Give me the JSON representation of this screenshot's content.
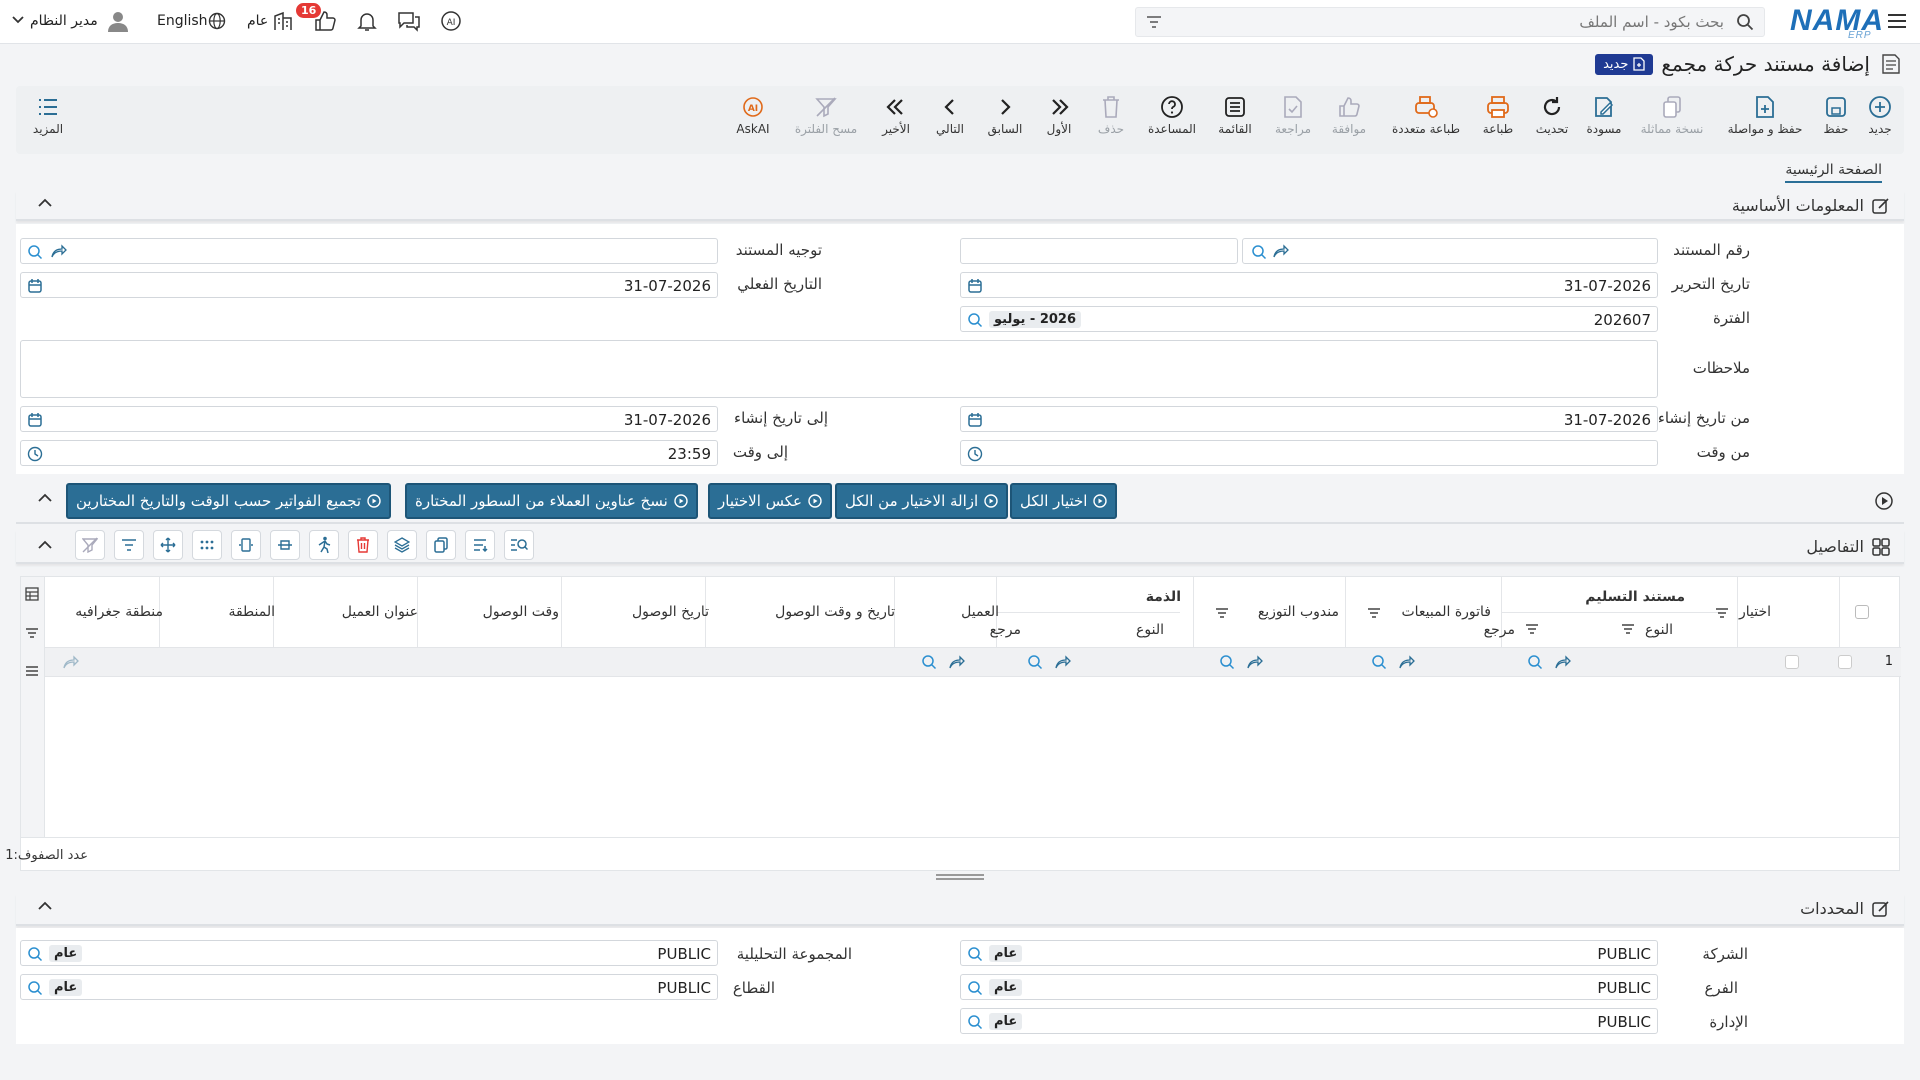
{
  "topbar": {
    "search_placeholder": "بحث بكود - اسم الملف",
    "logo": "NAMA",
    "logo_sub": "ERP",
    "user": "مدير النظام",
    "language": "English",
    "public_label": "عام",
    "notif_count": "16"
  },
  "page": {
    "title": "إضافة مستند حركة مجمع",
    "badge": "جديد"
  },
  "toolbar": {
    "new": "جديد",
    "save": "حفظ",
    "save_continue": "حفظ و مواصلة",
    "duplicate": "نسخة مماثلة",
    "draft": "مسودة",
    "refresh": "تحديث",
    "print": "طباعة",
    "multi_print": "طباعة متعددة",
    "approve": "موافقة",
    "review": "مراجعة",
    "list": "القائمة",
    "help": "المساعدة",
    "delete": "حذف",
    "first": "الأول",
    "previous": "السابق",
    "next": "التالي",
    "last": "الأخير",
    "clear_filter": "مسح الفلترة",
    "askai": "AskAI",
    "more": "المزيد"
  },
  "tabs": {
    "main": "الصفحة الرئيسية"
  },
  "basic_info": {
    "title": "المعلومات الأساسية",
    "doc_number_label": "رقم المستند",
    "doc_direction_label": "توجيه المستند",
    "edit_date_label": "تاريخ التحرير",
    "edit_date": "31-07-2026",
    "actual_date_label": "التاريخ الفعلي",
    "actual_date": "31-07-2026",
    "period_label": "الفترة",
    "period_value": "202607",
    "period_name": "2026 - يوليو",
    "notes_label": "ملاحظات",
    "from_create_label": "من تاريخ إنشاء",
    "from_create": "31-07-2026",
    "to_create_label": "إلى تاريخ إنشاء",
    "to_create": "31-07-2026",
    "from_time_label": "من وقت",
    "from_time": "",
    "to_time_label": "إلى وقت",
    "to_time": "23:59"
  },
  "actions": {
    "select_all": "اختيار الكل",
    "deselect_all": "ازالة الاختيار من الكل",
    "invert": "عكس الاختيار",
    "copy_addresses": "نسخ عناوين العملاء من السطور المختارة",
    "group_invoices": "تجميع الفواتير حسب الوقت والتاريخ المختارين"
  },
  "details": {
    "title": "التفاصيل",
    "columns": {
      "select": "اختيار",
      "delivery_doc": "مستند التسليم",
      "type": "النوع",
      "ref": "مرجع",
      "sales_invoice": "فاتورة المبيعات",
      "distributor": "مندوب التوزيع",
      "liability": "الذمة",
      "customer": "العميل",
      "arrival_datetime": "تاريخ و وقت الوصول",
      "arrival_date": "تاريخ الوصول",
      "arrival_time": "وقت الوصول",
      "customer_address": "عنوان العميل",
      "region": "المنطقة",
      "geo_region": "منطقة جغرافيه"
    },
    "row_number": "1",
    "row_count_label": "عدد الصفوف:",
    "row_count": "1"
  },
  "dimensions": {
    "title": "المحددات",
    "company_label": "الشركة",
    "company": "PUBLIC",
    "company_tag": "عام",
    "analytic_label": "المجموعة التحليلية",
    "analytic": "PUBLIC",
    "analytic_tag": "عام",
    "branch_label": "الفرع",
    "branch": "PUBLIC",
    "branch_tag": "عام",
    "sector_label": "القطاع",
    "sector": "PUBLIC",
    "sector_tag": "عام",
    "dept_label": "الإدارة",
    "dept": "PUBLIC",
    "dept_tag": "عام"
  },
  "colors": {
    "accent": "#2b6e95",
    "brand": "#1e6fb8",
    "danger": "#e53935",
    "badge": "#1f3a93"
  }
}
